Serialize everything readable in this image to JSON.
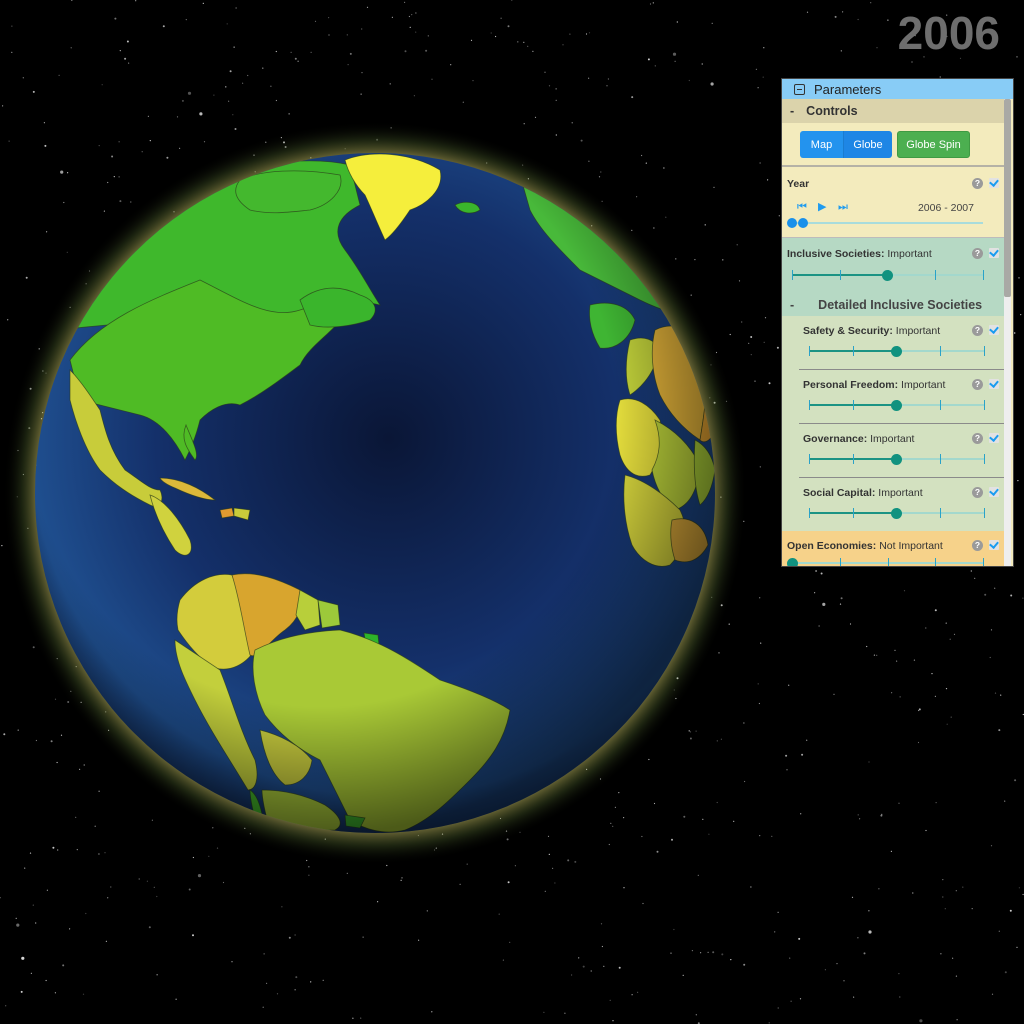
{
  "year_display": "2006",
  "globe": {
    "view": "Atlantic hemisphere",
    "colors": {
      "ocean_dark": "#0b1a3a",
      "ocean_light": "#1d4c8f",
      "green_high": "#36b52a",
      "green_mid": "#7cc22f",
      "yellow_green": "#b6c92c",
      "yellow": "#e6e23c",
      "orange": "#dca12c",
      "atmosphere_glow": "#f2e27a"
    }
  },
  "panel": {
    "title": "Parameters",
    "controls": {
      "section_label": "Controls",
      "collapse_symbol": "-",
      "buttons": [
        {
          "label": "Map",
          "active": false
        },
        {
          "label": "Globe",
          "active": true
        },
        {
          "label": "Globe Spin"
        }
      ]
    },
    "year": {
      "label": "Year",
      "range_text": "2006 - 2007",
      "help": "?",
      "checked": true,
      "controls": [
        "skip-back",
        "play",
        "skip-forward"
      ],
      "range_start_fraction": 0.0,
      "range_end_fraction": 0.06
    },
    "inclusive_societies": {
      "label": "Inclusive Societies:",
      "value": "Important",
      "help": "?",
      "checked": true,
      "level": 2,
      "levels": 5
    },
    "detailed": {
      "collapse_symbol": "-",
      "label": "Detailed Inclusive Societies",
      "items": [
        {
          "label": "Safety & Security:",
          "value": "Important",
          "level": 2,
          "checked": true
        },
        {
          "label": "Personal Freedom:",
          "value": "Important",
          "level": 2,
          "checked": true
        },
        {
          "label": "Governance:",
          "value": "Important",
          "level": 2,
          "checked": true
        },
        {
          "label": "Social Capital:",
          "value": "Important",
          "level": 2,
          "checked": true
        }
      ]
    },
    "open_economies": {
      "label": "Open Economies:",
      "value": "Not Important",
      "help": "?",
      "checked": true,
      "level": 0,
      "levels": 5
    }
  }
}
